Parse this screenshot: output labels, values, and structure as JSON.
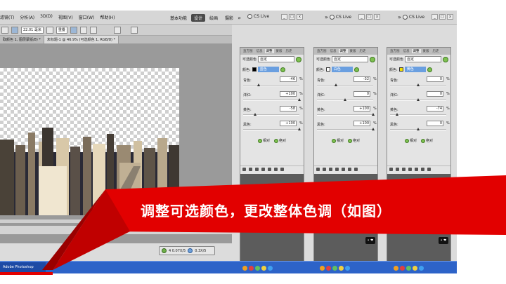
{
  "menubar": {
    "menus": [
      "滤镜(T)",
      "分析(A)",
      "3D(D)",
      "视图(V)",
      "窗口(W)",
      "帮助(H)"
    ],
    "workspaces": [
      "基本功能",
      "设计",
      "绘画",
      "摄影"
    ],
    "active_workspace": "设计",
    "cs_live": "CS Live"
  },
  "options": {
    "size_value": "22.01 毫米",
    "style_label": "重叠"
  },
  "doc_tabs": [
    "取颜色 1, 图层蒙版/8) *",
    "未标题-1 @ 46.9% (可选颜色 1, RGB/8) *"
  ],
  "mini_info": {
    "left": "4 0.07X/5",
    "right": "0.3X/5"
  },
  "panels": [
    {
      "tabs": [
        "直方图",
        "信息",
        "调整",
        "蒙版",
        "历史"
      ],
      "active_tab": "调整",
      "title": "可选颜色",
      "preset": "自定",
      "color_label": "颜色:",
      "color_value": "蓝色",
      "swatch": "#000000",
      "select_bg": "#6a9fe0",
      "rows": [
        {
          "label": "青色:",
          "value": "-46",
          "unit": "%",
          "pos": 0.27
        },
        {
          "label": "洋红:",
          "value": "+100",
          "unit": "%",
          "pos": 1.0
        },
        {
          "label": "黄色:",
          "value": "-58",
          "unit": "%",
          "pos": 0.21
        },
        {
          "label": "黑色:",
          "value": "+100",
          "unit": "%",
          "pos": 1.0
        }
      ],
      "relative": "相对",
      "absolute": "绝对"
    },
    {
      "tabs": [
        "直方图",
        "信息",
        "调整",
        "蒙版",
        "历史"
      ],
      "active_tab": "调整",
      "title": "可选颜色",
      "preset": "自定",
      "color_label": "颜色:",
      "color_value": "白色",
      "swatch": "#ffffff",
      "select_bg": "#6a9fe0",
      "rows": [
        {
          "label": "青色:",
          "value": "-32",
          "unit": "%",
          "pos": 0.34
        },
        {
          "label": "洋红:",
          "value": "0",
          "unit": "%",
          "pos": 0.5
        },
        {
          "label": "黄色:",
          "value": "+100",
          "unit": "%",
          "pos": 1.0
        },
        {
          "label": "黑色:",
          "value": "+100",
          "unit": "%",
          "pos": 1.0
        }
      ],
      "relative": "相对",
      "absolute": "绝对"
    },
    {
      "tabs": [
        "直方图",
        "信息",
        "调整",
        "蒙版",
        "历史"
      ],
      "active_tab": "调整",
      "title": "可选颜色",
      "preset": "自定",
      "color_label": "颜色:",
      "color_value": "黄色",
      "swatch": "#f0e000",
      "select_bg": "#6a9fe0",
      "rows": [
        {
          "label": "青色:",
          "value": "0",
          "unit": "%",
          "pos": 0.5
        },
        {
          "label": "洋红:",
          "value": "0",
          "unit": "%",
          "pos": 0.5
        },
        {
          "label": "黄色:",
          "value": "-74",
          "unit": "%",
          "pos": 0.13
        },
        {
          "label": "黑色:",
          "value": "0",
          "unit": "%",
          "pos": 0.5
        }
      ],
      "relative": "相对",
      "absolute": "绝对"
    }
  ],
  "taskbar": {
    "start_label": "Adobe Photoshop"
  },
  "banner": {
    "text": "调整可选颜色，更改整体色调（如图）",
    "color": "#e20000"
  }
}
